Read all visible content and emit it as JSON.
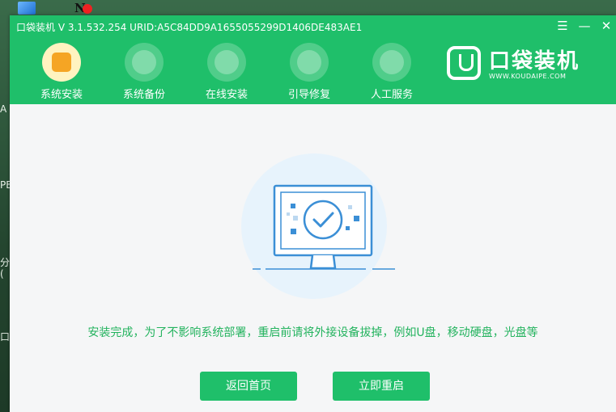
{
  "desktop": {
    "fragments": [
      "A",
      "PE",
      "分",
      "(",
      "口"
    ]
  },
  "window": {
    "title": "口袋装机 V 3.1.532.254 URID:A5C84DD9A1655055299D1406DE483AE1",
    "controls": {
      "menu": "☰",
      "minimize": "—",
      "close": "✕"
    }
  },
  "nav": {
    "items": [
      {
        "label": "系统安装",
        "icon": "windows-install-icon",
        "active": true
      },
      {
        "label": "系统备份",
        "icon": "backup-icon",
        "active": false
      },
      {
        "label": "在线安装",
        "icon": "download-icon",
        "active": false
      },
      {
        "label": "引导修复",
        "icon": "toolbox-icon",
        "active": false
      },
      {
        "label": "人工服务",
        "icon": "chat-icon",
        "active": false
      }
    ]
  },
  "brand": {
    "name": "口袋装机",
    "url": "WWW.KOUDAIPE.COM"
  },
  "main": {
    "message": "安装完成，为了不影响系统部署，重启前请将外接设备拔掉，例如U盘，移动硬盘，光盘等",
    "buttons": {
      "home": "返回首页",
      "restart": "立即重启"
    }
  },
  "colors": {
    "accent": "#1fbf6a",
    "message_text": "#23b35e",
    "illustration_blue": "#3b8fd6"
  }
}
